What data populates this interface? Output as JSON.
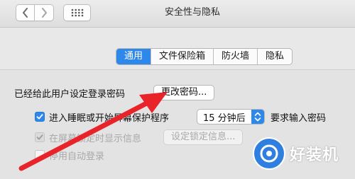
{
  "window": {
    "title": "安全性与隐私"
  },
  "toolbar": {
    "back_icon": "chevron-left-icon",
    "forward_icon": "chevron-right-icon",
    "grid_icon": "grid-dots-icon"
  },
  "tabs": [
    {
      "label": "通用",
      "active": true
    },
    {
      "label": "文件保险箱",
      "active": false
    },
    {
      "label": "防火墙",
      "active": false
    },
    {
      "label": "隐私",
      "active": false
    }
  ],
  "general": {
    "password_set_label": "已经给此用户设定登录密码",
    "change_password_button": "更改密码...",
    "require_password": {
      "label": "进入睡眠或开始屏幕保护程序",
      "checked": true,
      "delay_value": "15 分钟后",
      "suffix": "要求输入密码"
    },
    "show_message": {
      "label": "在屏幕锁定时显示信息",
      "checked": true,
      "enabled": false,
      "button": "设定锁定信息..."
    },
    "disable_auto_login": {
      "label": "停用自动登录",
      "checked": false
    }
  },
  "watermark": {
    "text": "好装机"
  },
  "colors": {
    "accent": "#2d88ea",
    "annotation_arrow": "#e8232a"
  }
}
